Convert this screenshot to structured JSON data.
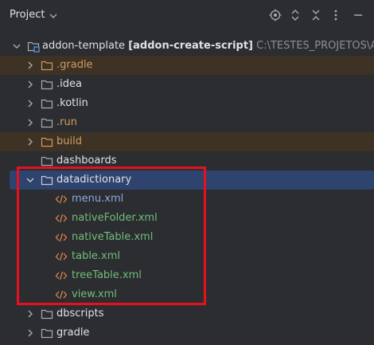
{
  "header": {
    "title": "Project"
  },
  "root": {
    "name": "addon-template",
    "module": "[addon-create-script]",
    "path": "C:\\TESTES_PROJETOS\\Addo"
  },
  "items": [
    {
      "label": ".gradle"
    },
    {
      "label": ".idea"
    },
    {
      "label": ".kotlin"
    },
    {
      "label": ".run"
    },
    {
      "label": "build"
    },
    {
      "label": "dashboards"
    },
    {
      "label": "datadictionary"
    },
    {
      "label": "menu.xml"
    },
    {
      "label": "nativeFolder.xml"
    },
    {
      "label": "nativeTable.xml"
    },
    {
      "label": "table.xml"
    },
    {
      "label": "treeTable.xml"
    },
    {
      "label": "view.xml"
    },
    {
      "label": "dbscripts"
    },
    {
      "label": "gradle"
    }
  ],
  "colors": {
    "background": "#2b2d30",
    "excluded_row": "#3d3223",
    "selected_row": "#2e436e",
    "highlight_box": "#e8101f"
  }
}
